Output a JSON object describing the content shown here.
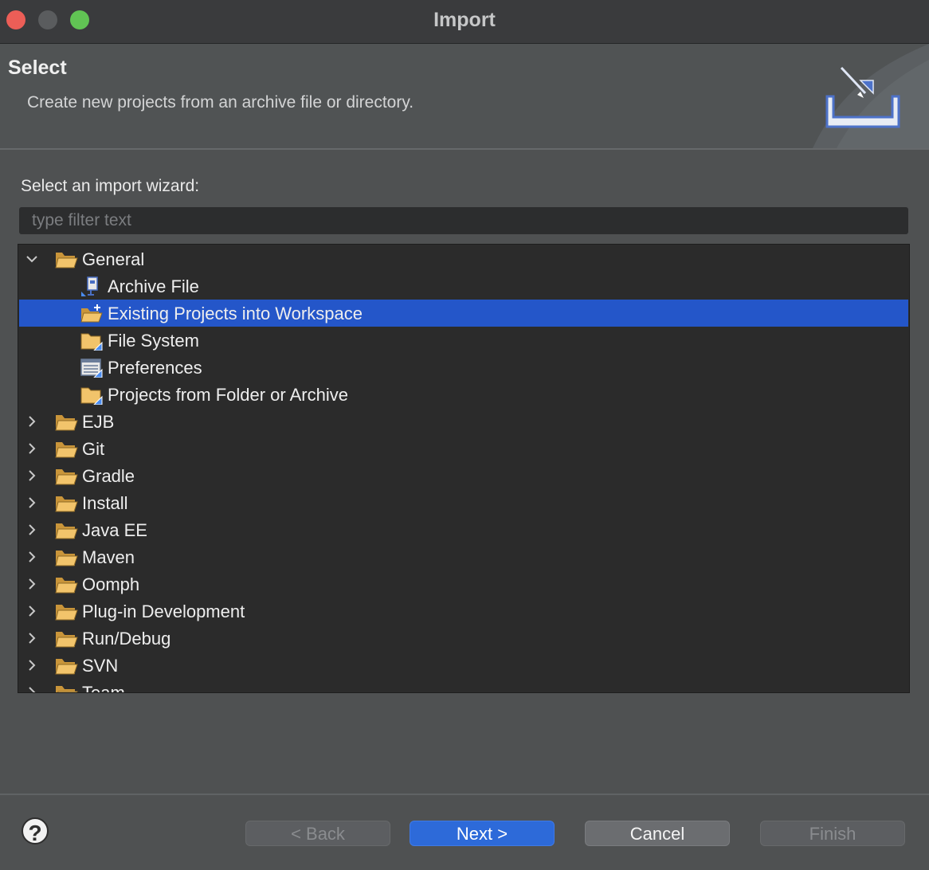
{
  "window": {
    "title": "Import"
  },
  "header": {
    "title": "Select",
    "description": "Create new projects from an archive file or directory.",
    "banner_icon": "import-wizard-icon"
  },
  "wizard": {
    "prompt": "Select an import wizard:",
    "filter_placeholder": "type filter text",
    "filter_value": ""
  },
  "tree": {
    "items": [
      {
        "label": "General",
        "level": 0,
        "expanded": true,
        "icon": "folder-open-icon"
      },
      {
        "label": "Archive File",
        "level": 1,
        "icon": "archive-file-icon"
      },
      {
        "label": "Existing Projects into Workspace",
        "level": 1,
        "icon": "existing-project-icon",
        "selected": true
      },
      {
        "label": "File System",
        "level": 1,
        "icon": "folder-icon"
      },
      {
        "label": "Preferences",
        "level": 1,
        "icon": "preferences-icon"
      },
      {
        "label": "Projects from Folder or Archive",
        "level": 1,
        "icon": "folder-icon"
      },
      {
        "label": "EJB",
        "level": 0,
        "expanded": false,
        "icon": "folder-open-icon"
      },
      {
        "label": "Git",
        "level": 0,
        "expanded": false,
        "icon": "folder-open-icon"
      },
      {
        "label": "Gradle",
        "level": 0,
        "expanded": false,
        "icon": "folder-open-icon"
      },
      {
        "label": "Install",
        "level": 0,
        "expanded": false,
        "icon": "folder-open-icon"
      },
      {
        "label": "Java EE",
        "level": 0,
        "expanded": false,
        "icon": "folder-open-icon"
      },
      {
        "label": "Maven",
        "level": 0,
        "expanded": false,
        "icon": "folder-open-icon"
      },
      {
        "label": "Oomph",
        "level": 0,
        "expanded": false,
        "icon": "folder-open-icon"
      },
      {
        "label": "Plug-in Development",
        "level": 0,
        "expanded": false,
        "icon": "folder-open-icon"
      },
      {
        "label": "Run/Debug",
        "level": 0,
        "expanded": false,
        "icon": "folder-open-icon"
      },
      {
        "label": "SVN",
        "level": 0,
        "expanded": false,
        "icon": "folder-open-icon"
      },
      {
        "label": "Team",
        "level": 0,
        "expanded": false,
        "icon": "folder-open-icon"
      }
    ]
  },
  "footer": {
    "help_label": "?",
    "back_label": "< Back",
    "next_label": "Next >",
    "cancel_label": "Cancel",
    "finish_label": "Finish"
  },
  "colors": {
    "selection": "#2456c9",
    "primary_button": "#2d6ad9",
    "folder": "#f2c46b"
  }
}
